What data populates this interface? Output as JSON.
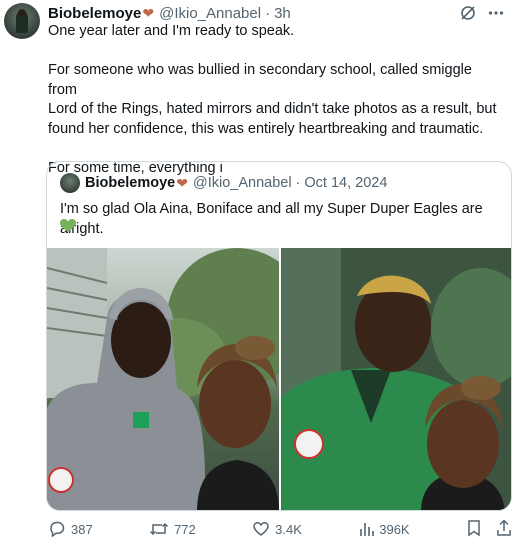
{
  "tweet": {
    "author_name": "Biobelemoye",
    "heart": "❤",
    "handle": "@Ikio_Annabel",
    "separator": "·",
    "time": "3h",
    "text": "One year later and I'm ready to speak.\n\nFor someone who was bullied in secondary school, called smiggle from\nLord of the Rings, hated mirrors and didn't take photos as a result, but\nfound her confidence, this was entirely heartbreaking and traumatic.\n\nFor some time, everything i"
  },
  "quote": {
    "author_name": "Biobelemoye",
    "heart": "❤",
    "handle": "@Ikio_Annabel",
    "separator": "·",
    "date": "Oct 14, 2024",
    "text": "I'm so glad Ola Aina, Boniface and all my Super Duper Eagles are alright."
  },
  "actions": {
    "replies": "387",
    "reposts": "772",
    "likes": "3.4K",
    "views": "396K"
  },
  "colors": {
    "heart": "#c0684a",
    "green_heart": "#78b159",
    "muted": "#536471",
    "border": "#cfd9de"
  },
  "icons": [
    "grok-icon",
    "more-icon",
    "reply-icon",
    "repost-icon",
    "like-icon",
    "views-icon",
    "bookmark-icon",
    "share-icon",
    "green-heart-icon"
  ]
}
